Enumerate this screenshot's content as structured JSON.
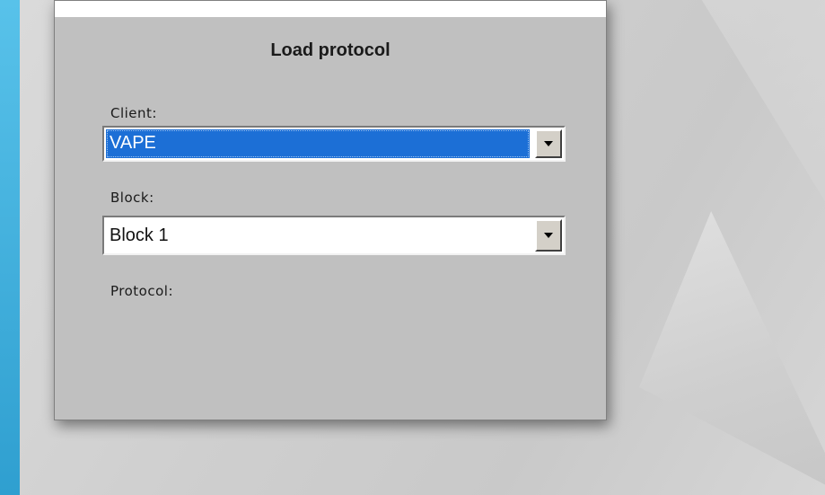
{
  "dialog": {
    "title": "Load protocol",
    "client": {
      "label": "Client:",
      "selected_value": "VAPE"
    },
    "block": {
      "label": "Block:",
      "selected_value": "Block 1"
    },
    "protocol": {
      "label": "Protocol:"
    }
  },
  "colors": {
    "dialog_bg": "#c0c0c0",
    "selection_highlight": "#1c6fd6",
    "slide_accent": "#45b0dc"
  },
  "icons": {
    "dropdown_arrow": "chevron-down-icon"
  }
}
